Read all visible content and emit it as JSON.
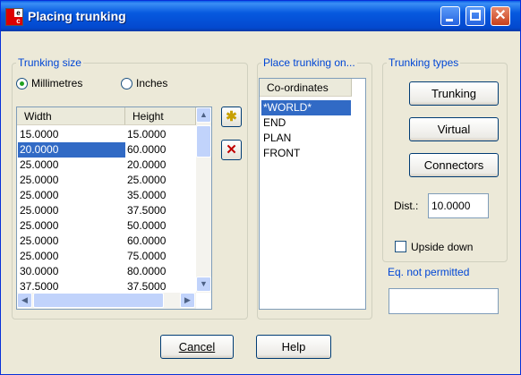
{
  "window": {
    "title": "Placing trunking"
  },
  "app_icon_letters": [
    "e",
    "c"
  ],
  "trunking_size": {
    "legend": "Trunking size",
    "radio_mm": "Millimetres",
    "radio_in": "Inches",
    "selected": "Millimetres",
    "columns": [
      "Width",
      "Height"
    ],
    "rows": [
      [
        "15.0000",
        "15.0000"
      ],
      [
        "20.0000",
        "60.0000"
      ],
      [
        "25.0000",
        "20.0000"
      ],
      [
        "25.0000",
        "25.0000"
      ],
      [
        "25.0000",
        "35.0000"
      ],
      [
        "25.0000",
        "37.5000"
      ],
      [
        "25.0000",
        "50.0000"
      ],
      [
        "25.0000",
        "60.0000"
      ],
      [
        "25.0000",
        "75.0000"
      ],
      [
        "30.0000",
        "80.0000"
      ],
      [
        "37.5000",
        "37.5000"
      ]
    ],
    "selected_row": 1
  },
  "place_trunking": {
    "legend": "Place trunking on...",
    "column": "Co-ordinates",
    "items": [
      "*WORLD*",
      "END",
      "PLAN",
      "FRONT"
    ],
    "selected_item": 0
  },
  "trunking_types": {
    "legend": "Trunking types",
    "buttons": [
      "Trunking",
      "Virtual",
      "Connectors"
    ],
    "dist_label": "Dist.:",
    "dist_value": "10.0000",
    "upside_down_label": "Upside down"
  },
  "eq_not_permitted": {
    "legend": "Eq. not permitted",
    "value": ""
  },
  "footer": {
    "cancel": "Cancel",
    "help": "Help"
  }
}
